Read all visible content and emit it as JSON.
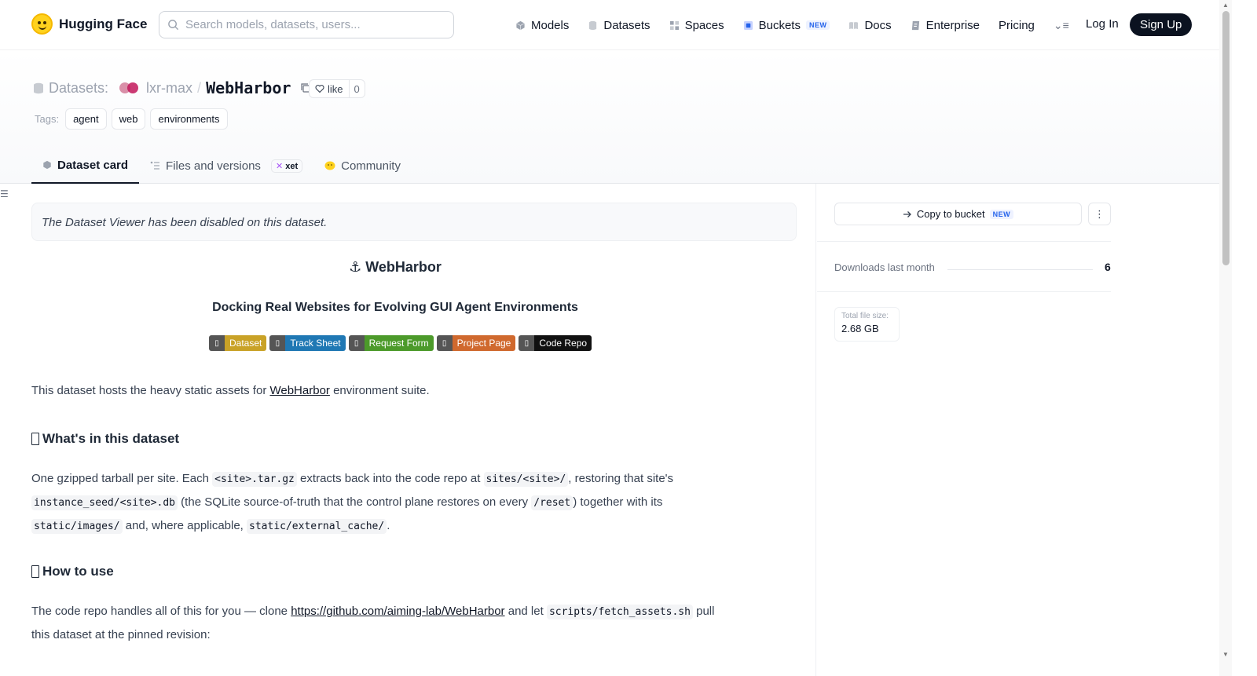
{
  "nav": {
    "brand": "Hugging Face",
    "search_placeholder": "Search models, datasets, users...",
    "items": [
      {
        "label": "Models",
        "icon": "cube-icon"
      },
      {
        "label": "Datasets",
        "icon": "database-icon"
      },
      {
        "label": "Spaces",
        "icon": "grid-icon"
      },
      {
        "label": "Buckets",
        "icon": "bucket-icon",
        "badge": "NEW"
      },
      {
        "label": "Docs",
        "icon": "book-icon"
      },
      {
        "label": "Enterprise",
        "icon": "enterprise-icon"
      },
      {
        "label": "Pricing"
      }
    ],
    "login": "Log In",
    "signup": "Sign Up"
  },
  "repo": {
    "type_label": "Datasets:",
    "owner": "lxr-max",
    "separator": "/",
    "name": "WebHarbor",
    "like_label": "like",
    "like_count": "0",
    "tags_label": "Tags:",
    "tags": [
      "agent",
      "web",
      "environments"
    ]
  },
  "tabs": [
    {
      "label": "Dataset card",
      "active": true
    },
    {
      "label": "Files and versions",
      "badge": "xet"
    },
    {
      "label": "Community"
    }
  ],
  "card": {
    "viewer_notice": "The Dataset Viewer has been disabled on this dataset.",
    "title": "⚓ WebHarbor",
    "subtitle": "Docking Real Websites for Evolving GUI Agent Environments",
    "badges": [
      {
        "label": "Dataset",
        "color": "#c9a227"
      },
      {
        "label": "Track Sheet",
        "color": "#1f78b4"
      },
      {
        "label": "Request Form",
        "color": "#4c9a2a"
      },
      {
        "label": "Project Page",
        "color": "#d0692e"
      },
      {
        "label": "Code Repo",
        "color": "#111111"
      }
    ],
    "intro_prefix": "This dataset hosts the heavy static assets for ",
    "intro_link": "WebHarbor",
    "intro_suffix": " environment suite.",
    "section1_title": "What's in this dataset",
    "section1": {
      "t1": "One gzipped tarball per site. Each ",
      "c1": "<site>.tar.gz",
      "t2": " extracts back into the code repo at ",
      "c2": "sites/<site>/",
      "t3": ", restoring that site's",
      "c3": "instance_seed/<site>.db",
      "t4": " (the SQLite source-of-truth that the control plane restores on every ",
      "c4": "/reset",
      "t5": ") together with its",
      "c5": "static/images/",
      "t6": " and, where applicable, ",
      "c6": "static/external_cache/",
      "t7": "."
    },
    "section2_title": "How to use",
    "section2": {
      "t1": "The code repo handles all of this for you — clone ",
      "link": "https://github.com/aiming-lab/WebHarbor",
      "t2": " and let ",
      "c1": "scripts/fetch_assets.sh",
      "t3": " pull",
      "t4": "this dataset at the pinned revision:"
    }
  },
  "sidebar": {
    "copy_bucket": "Copy to bucket",
    "copy_bucket_badge": "NEW",
    "downloads_label": "Downloads last month",
    "downloads_value": "6",
    "file_size_label": "Total file size:",
    "file_size_value": "2.68 GB"
  }
}
